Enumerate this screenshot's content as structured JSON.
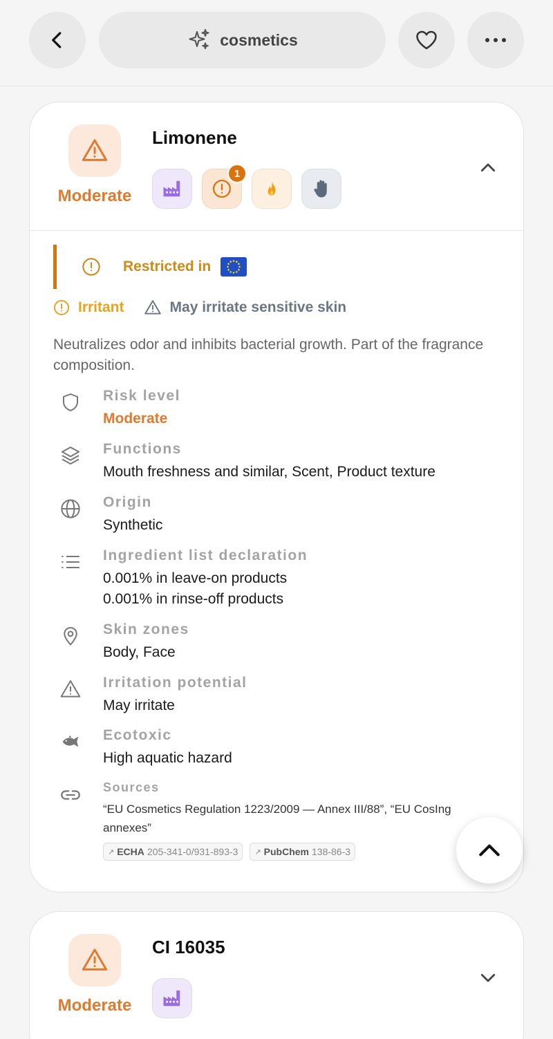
{
  "header": {
    "back_icon": "chevron-left-icon",
    "title": "cosmetics",
    "title_icon": "sparkles-icon",
    "favorite_icon": "heart-icon",
    "more_icon": "more-horizontal-icon"
  },
  "ingredients": [
    {
      "name": "Limonene",
      "risk": "Moderate",
      "risk_color": "#e07a2e",
      "expanded": true,
      "badges": [
        {
          "icon": "factory-icon",
          "count": ""
        },
        {
          "icon": "alert-circle-icon",
          "count": "1"
        },
        {
          "icon": "fire-icon",
          "count": ""
        },
        {
          "icon": "hand-icon",
          "count": ""
        }
      ],
      "restricted_label": "Restricted in",
      "restricted_region": "EU",
      "tags": {
        "irritant": "Irritant",
        "sensitive": "May irritate sensitive skin"
      },
      "description": "Neutralizes odor and inhibits bacterial growth. Part of the fragrance composition.",
      "properties": {
        "risk": {
          "label": "Risk level",
          "value": "Moderate"
        },
        "functions": {
          "label": "Functions",
          "value": "Mouth freshness and similar, Scent, Product texture"
        },
        "origin": {
          "label": "Origin",
          "value": "Synthetic"
        },
        "declaration": {
          "label": "Ingredient list declaration",
          "line1": "0.001% in leave-on products",
          "line2": "0.001% in rinse-off products"
        },
        "zones": {
          "label": "Skin zones",
          "value": "Body, Face"
        },
        "irritation": {
          "label": "Irritation potential",
          "value": "May irritate"
        },
        "ecotoxic": {
          "label": "Ecotoxic",
          "value": "High aquatic hazard"
        },
        "sources": {
          "label": "Sources",
          "text": "“EU Cosmetics Regulation 1223/2009 — Annex III/88”, “EU CosIng annexes”",
          "chips": [
            {
              "name": "ECHA",
              "value": "205-341-0/931-893-3"
            },
            {
              "name": "PubChem",
              "value": "138-86-3"
            }
          ]
        }
      }
    },
    {
      "name": "CI 16035",
      "risk": "Moderate",
      "expanded": false,
      "badges": [
        {
          "icon": "factory-icon",
          "count": ""
        }
      ]
    }
  ],
  "scroll_top_icon": "chevron-up-icon"
}
